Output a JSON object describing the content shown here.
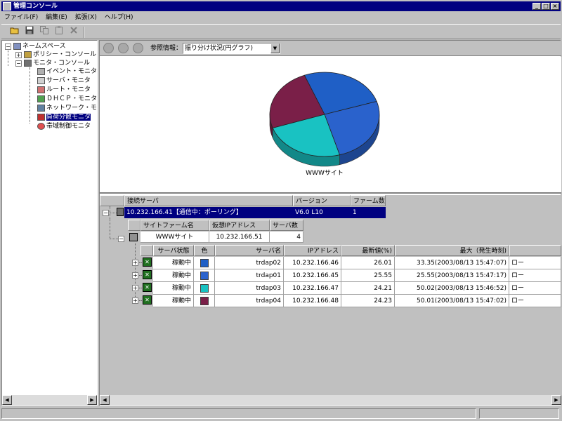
{
  "window": {
    "title": "管理コンソール",
    "min": "_",
    "max": "□",
    "close": "×"
  },
  "menu": [
    "ファイル(F)",
    "編集(E)",
    "拡張(X)",
    "ヘルプ(H)"
  ],
  "tree": {
    "root": "ネームスペース",
    "policy": "ポリシー・コンソール",
    "monitor": "モニタ・コンソール",
    "children": [
      "イベント・モニタ",
      "サーバ・モニタ",
      "ルート・モニタ",
      "ＤＨＣＰ・モニタ",
      "ネットワーク・モ",
      "負荷分散モニタ",
      "帯域制御モニタ"
    ],
    "selected_index": 5
  },
  "ref": {
    "label": "参照情報：",
    "value": "振り分け状況(円グラフ)"
  },
  "chart_data": {
    "type": "pie",
    "xlabel": "WWWサイト",
    "categories": [
      "trdap02",
      "trdap01",
      "trdap03",
      "trdap04"
    ],
    "values": [
      26.01,
      25.55,
      24.21,
      24.23
    ],
    "colors": [
      "#1f5fc6",
      "#2a62cc",
      "#19c2c2",
      "#7a1f48"
    ]
  },
  "grid": {
    "headers": {
      "server": "接続サーバ",
      "version": "バージョン",
      "farms": "ファーム数"
    },
    "server_row": {
      "server": "10.232.166.41【通信中：ポーリング】",
      "version": "V6.0 L10",
      "farms": "1"
    },
    "farm_headers": {
      "name": "サイトファーム名",
      "vip": "仮想IPアドレス",
      "count": "サーバ数"
    },
    "farm_row": {
      "name": "WWWサイト",
      "vip": "10.232.166.51",
      "count": "4"
    },
    "detail_headers": {
      "status": "サーバ状態",
      "color": "色",
      "name": "サーバ名",
      "ip": "IPアドレス",
      "latest": "最新値(%)",
      "max": "最大（発生時刻)",
      "extra": ""
    },
    "rows": [
      {
        "status": "稼動中",
        "color": "#1f5fc6",
        "name": "trdap02",
        "ip": "10.232.166.46",
        "latest": "26.01",
        "max": "33.35(2003/08/13 15:47:07)",
        "extra": "ロー"
      },
      {
        "status": "稼動中",
        "color": "#2a62cc",
        "name": "trdap01",
        "ip": "10.232.166.45",
        "latest": "25.55",
        "max": "25.55(2003/08/13 15:47:17)",
        "extra": "ロー"
      },
      {
        "status": "稼動中",
        "color": "#19c2c2",
        "name": "trdap03",
        "ip": "10.232.166.47",
        "latest": "24.21",
        "max": "50.02(2003/08/13 15:46:52)",
        "extra": "ロー"
      },
      {
        "status": "稼動中",
        "color": "#7a1f48",
        "name": "trdap04",
        "ip": "10.232.166.48",
        "latest": "24.23",
        "max": "50.01(2003/08/13 15:47:02)",
        "extra": "ロー"
      }
    ]
  }
}
